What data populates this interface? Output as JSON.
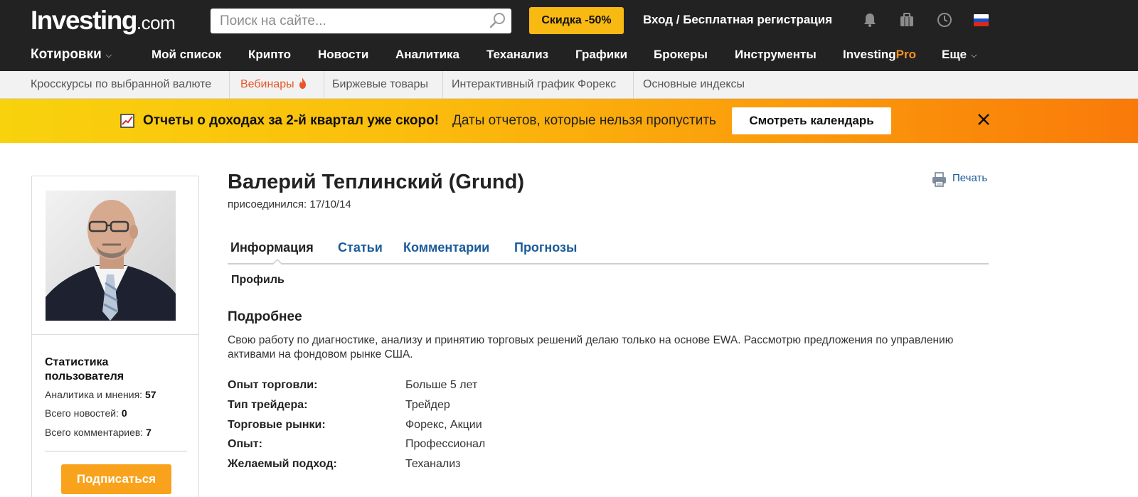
{
  "header": {
    "logo_main": "Investing",
    "logo_domain": ".com",
    "search_placeholder": "Поиск на сайте...",
    "promo_label": "Скидка -50%",
    "login_label": "Вход / Бесплатная регистрация",
    "icons": [
      "bell-icon",
      "briefcase-icon",
      "clock-icon",
      "russia-flag-icon"
    ]
  },
  "main_nav": {
    "quotes_label": "Котировки",
    "items": [
      "Мой список",
      "Крипто",
      "Новости",
      "Аналитика",
      "Теханализ",
      "Графики",
      "Брокеры",
      "Инструменты"
    ],
    "pro_main": "Investing",
    "pro_suffix": "Pro",
    "more_label": "Еще"
  },
  "sub_nav": {
    "items": [
      "Кросскурсы по выбранной валюте",
      "Вебинары",
      "Биржевые товары",
      "Интерактивный график Форекс",
      "Основные индексы"
    ],
    "hot_item_index": 1
  },
  "banner": {
    "bold_text": "Отчеты о доходах за 2-й квартал уже скоро!",
    "text": "Даты отчетов, которые нельзя пропустить",
    "button_label": "Смотреть календарь"
  },
  "sidebar": {
    "stats_title": "Статистика пользователя",
    "stats": [
      {
        "label": "Аналитика и мнения:",
        "value": "57"
      },
      {
        "label": "Всего новостей:",
        "value": "0"
      },
      {
        "label": "Всего комментариев:",
        "value": "7"
      }
    ],
    "subscribe_label": "Подписаться"
  },
  "profile": {
    "name": "Валерий Теплинский (Grund)",
    "joined": "присоединился: 17/10/14",
    "print_label": "Печать",
    "tabs": [
      "Информация",
      "Статьи",
      "Комментарии",
      "Прогнозы"
    ],
    "active_tab": "Информация",
    "subtab": "Профиль",
    "section_title": "Подробнее",
    "about": "Свою работу по диагностике, анализу и принятию торговых решений делаю только на основе EWA. Рассмотрю предложения по управлению активами на фондовом рынке США.",
    "details": [
      {
        "label": "Опыт торговли:",
        "value": "Больше 5 лет"
      },
      {
        "label": "Тип трейдера:",
        "value": "Трейдер"
      },
      {
        "label": "Торговые рынки:",
        "value": "Форекс, Акции"
      },
      {
        "label": "Опыт:",
        "value": "Профессионал"
      },
      {
        "label": "Желаемый подход:",
        "value": "Теханализ"
      }
    ]
  },
  "colors": {
    "header_bg": "#222222",
    "promo_bg": "#f9b913",
    "link_blue": "#1a5b9a",
    "hot_orange": "#e8562a",
    "subscribe_bg": "#f9a21b",
    "pro_orange": "#f7931e"
  }
}
